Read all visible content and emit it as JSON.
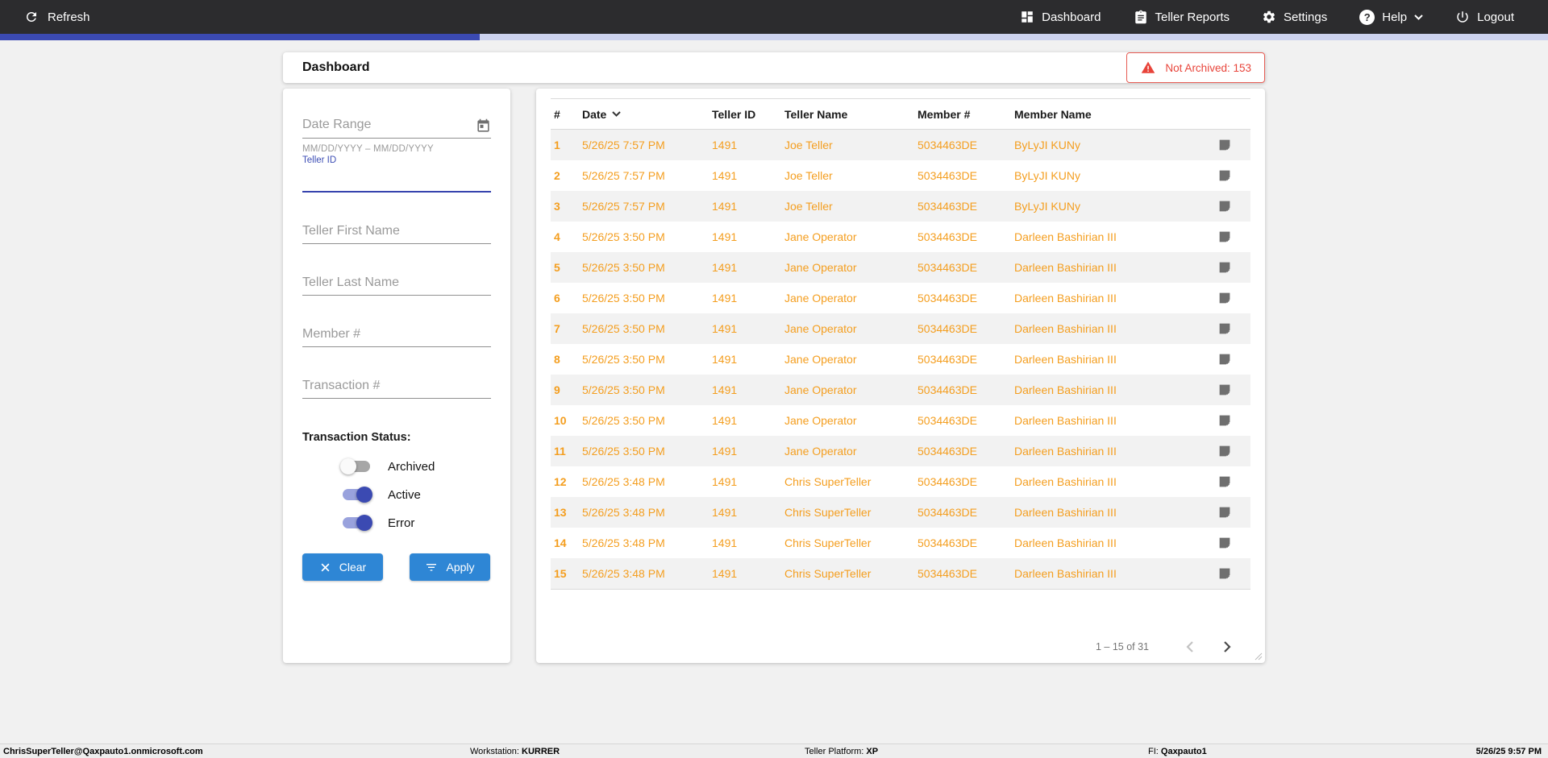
{
  "topbar": {
    "refresh_label": "Refresh",
    "nav": [
      {
        "label": "Dashboard",
        "icon": "dashboard-icon"
      },
      {
        "label": "Teller Reports",
        "icon": "reports-icon"
      },
      {
        "label": "Settings",
        "icon": "settings-icon"
      },
      {
        "label": "Help",
        "icon": "help-icon",
        "has_dropdown": true
      },
      {
        "label": "Logout",
        "icon": "logout-icon"
      }
    ]
  },
  "progress": {
    "percent": 31
  },
  "page": {
    "title": "Dashboard",
    "alert_badge": "Not Archived: 153",
    "alert_icon": "warning-icon"
  },
  "filters": {
    "date_range": {
      "placeholder": "Date Range",
      "helper": "MM/DD/YYYY – MM/DD/YYYY",
      "icon": "calendar-icon"
    },
    "teller_id_label": "Teller ID",
    "teller_id_value": "",
    "fields": [
      {
        "placeholder": "Teller First Name",
        "value": ""
      },
      {
        "placeholder": "Teller Last Name",
        "value": ""
      },
      {
        "placeholder": "Member #",
        "value": ""
      },
      {
        "placeholder": "Transaction #",
        "value": ""
      }
    ],
    "status_label": "Transaction Status:",
    "toggles": [
      {
        "label": "Archived",
        "on": false
      },
      {
        "label": "Active",
        "on": true
      },
      {
        "label": "Error",
        "on": true
      }
    ],
    "clear_label": "Clear",
    "apply_label": "Apply"
  },
  "table": {
    "columns": [
      "#",
      "Date",
      "Teller ID",
      "Teller Name",
      "Member #",
      "Member Name"
    ],
    "sorted_column": "Date",
    "sort_direction": "desc",
    "rows": [
      {
        "num": "1",
        "date": "5/26/25 7:57 PM",
        "teller_id": "1491",
        "teller_name": "Joe Teller",
        "member_num": "5034463DE",
        "member_name": "ByLyJI KUNy"
      },
      {
        "num": "2",
        "date": "5/26/25 7:57 PM",
        "teller_id": "1491",
        "teller_name": "Joe Teller",
        "member_num": "5034463DE",
        "member_name": "ByLyJI KUNy"
      },
      {
        "num": "3",
        "date": "5/26/25 7:57 PM",
        "teller_id": "1491",
        "teller_name": "Joe Teller",
        "member_num": "5034463DE",
        "member_name": "ByLyJI KUNy"
      },
      {
        "num": "4",
        "date": "5/26/25 3:50 PM",
        "teller_id": "1491",
        "teller_name": "Jane Operator",
        "member_num": "5034463DE",
        "member_name": "Darleen Bashirian III"
      },
      {
        "num": "5",
        "date": "5/26/25 3:50 PM",
        "teller_id": "1491",
        "teller_name": "Jane Operator",
        "member_num": "5034463DE",
        "member_name": "Darleen Bashirian III"
      },
      {
        "num": "6",
        "date": "5/26/25 3:50 PM",
        "teller_id": "1491",
        "teller_name": "Jane Operator",
        "member_num": "5034463DE",
        "member_name": "Darleen Bashirian III"
      },
      {
        "num": "7",
        "date": "5/26/25 3:50 PM",
        "teller_id": "1491",
        "teller_name": "Jane Operator",
        "member_num": "5034463DE",
        "member_name": "Darleen Bashirian III"
      },
      {
        "num": "8",
        "date": "5/26/25 3:50 PM",
        "teller_id": "1491",
        "teller_name": "Jane Operator",
        "member_num": "5034463DE",
        "member_name": "Darleen Bashirian III"
      },
      {
        "num": "9",
        "date": "5/26/25 3:50 PM",
        "teller_id": "1491",
        "teller_name": "Jane Operator",
        "member_num": "5034463DE",
        "member_name": "Darleen Bashirian III"
      },
      {
        "num": "10",
        "date": "5/26/25 3:50 PM",
        "teller_id": "1491",
        "teller_name": "Jane Operator",
        "member_num": "5034463DE",
        "member_name": "Darleen Bashirian III"
      },
      {
        "num": "11",
        "date": "5/26/25 3:50 PM",
        "teller_id": "1491",
        "teller_name": "Jane Operator",
        "member_num": "5034463DE",
        "member_name": "Darleen Bashirian III"
      },
      {
        "num": "12",
        "date": "5/26/25 3:48 PM",
        "teller_id": "1491",
        "teller_name": "Chris SuperTeller",
        "member_num": "5034463DE",
        "member_name": "Darleen Bashirian III"
      },
      {
        "num": "13",
        "date": "5/26/25 3:48 PM",
        "teller_id": "1491",
        "teller_name": "Chris SuperTeller",
        "member_num": "5034463DE",
        "member_name": "Darleen Bashirian III"
      },
      {
        "num": "14",
        "date": "5/26/25 3:48 PM",
        "teller_id": "1491",
        "teller_name": "Chris SuperTeller",
        "member_num": "5034463DE",
        "member_name": "Darleen Bashirian III"
      },
      {
        "num": "15",
        "date": "5/26/25 3:48 PM",
        "teller_id": "1491",
        "teller_name": "Chris SuperTeller",
        "member_num": "5034463DE",
        "member_name": "Darleen Bashirian III"
      }
    ],
    "row_note_icon": "note-icon",
    "pagination": {
      "range_label": "1 – 15 of 31",
      "prev_enabled": false,
      "next_enabled": true
    }
  },
  "statusbar": {
    "user": "ChrisSuperTeller@Qaxpauto1.onmicrosoft.com",
    "workstation_label": "Workstation: ",
    "workstation": "KURRER",
    "platform_label": "Teller Platform: ",
    "platform": "XP",
    "fi_label": "FI: ",
    "fi": "Qaxpauto1",
    "datetime": "5/26/25 9:57 PM"
  },
  "colors": {
    "topbar_bg": "#2c2c2e",
    "accent_indigo": "#3b4ab2",
    "row_text_orange": "#f49e1f",
    "alert_red": "#e8443a",
    "button_blue": "#2e86d5"
  }
}
